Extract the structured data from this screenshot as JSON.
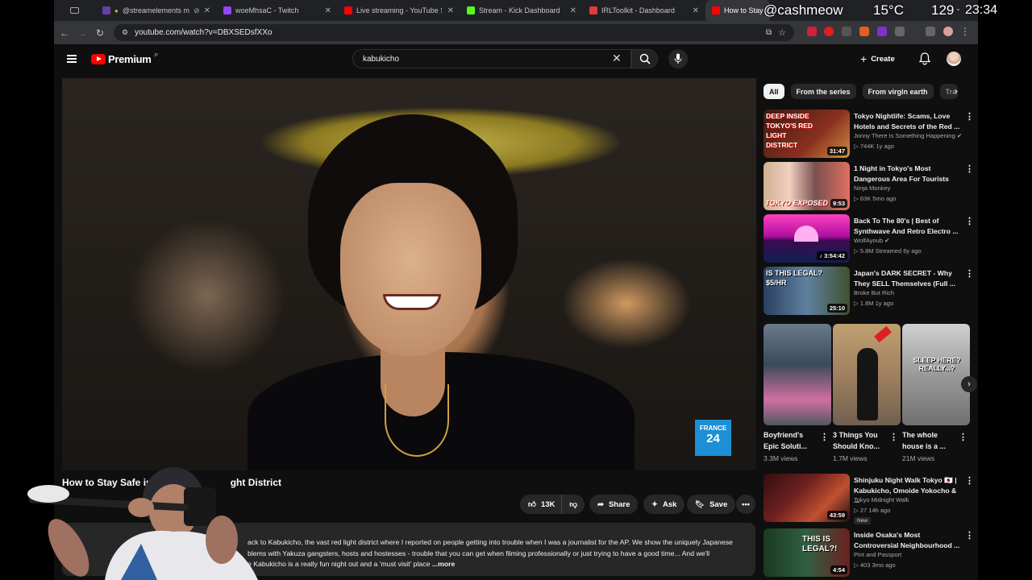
{
  "browser": {
    "tabs": [
      {
        "title": "@streamelements me",
        "fav": "#6441a5"
      },
      {
        "title": "woeMhsaC - Twitch",
        "fav": "#9146ff"
      },
      {
        "title": "Live streaming - YouTube Stu",
        "fav": "#ff0000"
      },
      {
        "title": "Stream - Kick Dashboard",
        "fav": "#53fc18"
      },
      {
        "title": "IRLToolkit - Dashboard",
        "fav": "#e23b3b"
      },
      {
        "title": "How to Stay",
        "fav": "#ff0000"
      }
    ],
    "url": "youtube.com/watch?v=DBXSEDsfXXo"
  },
  "stream_overlay": {
    "handle": "@cashmeow",
    "temperature": "15°C",
    "count": "129",
    "time": "23:34"
  },
  "youtube": {
    "logo": "Premium",
    "logo_region": "JP",
    "search_value": "kabukicho",
    "create_label": "Create",
    "video": {
      "title_left": "How to Stay Safe in T",
      "title_right": "ght District",
      "channel_watermark_line1": "FRANCE",
      "channel_watermark_line2": "24",
      "like_count": "13K",
      "share_label": "Share",
      "ask_label": "Ask",
      "save_label": "Save",
      "description_line1": "ack to Kabukicho, the vast red light district where I reported on people getting into trouble when I was a journalist for the AP. We show the uniquely Japanese",
      "description_line2": "blems with Yakuza gangsters, hosts and hostesses - trouble that you can get when filming professionally or just trying to have a good time... And we'll",
      "description_line3": "e Kabukicho is a really fun night out and a 'must visit' place",
      "more_label": "...more"
    },
    "chips": [
      "All",
      "From the series",
      "From virgin earth",
      "Tra"
    ],
    "recommendations": [
      {
        "title": "Tokyo Nightlife: Scams, Love Hotels and Secrets of the Red ...",
        "channel": "Jonny There Is Something Happening",
        "verified": true,
        "meta": "▷ 744K  1y ago",
        "duration": "31:47",
        "thumb_text": "DEEP INSIDE TOKYO'S RED LIGHT DISTRICT",
        "thumb_color": "#8a3020"
      },
      {
        "title": "1 Night in Tokyo's Most Dangerous Area For Tourists",
        "channel": "Ninja Monkey",
        "verified": false,
        "meta": "▷ 63K  5mo ago",
        "duration": "9:53",
        "thumb_text": "TOKYO EXPOSED",
        "thumb_color": "#b05040"
      },
      {
        "title": "Back To The 80's | Best of Synthwave And Retro Electro ...",
        "channel": "WolfAyoub",
        "verified": true,
        "meta": "▷ 5.8M  Streamed 6y ago",
        "duration": "3:54:42",
        "thumb_text": "",
        "thumb_color": "#c02090"
      },
      {
        "title": "Japan's DARK SECRET - Why They SELL Themselves (Full ...",
        "channel": "Broke But Rich",
        "verified": false,
        "meta": "▷ 1.8M  1y ago",
        "duration": "25:10",
        "thumb_text": "IS THIS LEGAL? $5/HR",
        "thumb_color": "#406080"
      }
    ],
    "shorts": [
      {
        "title": "Boyfriend's Epic Soluti...",
        "views": "3.3M views",
        "color": "#506070"
      },
      {
        "title": "3 Things You Should Kno...",
        "views": "1.7M views",
        "color": "#a08060"
      },
      {
        "title": "The whole house is a ...",
        "views": "21M views",
        "color": "#8a8a8a",
        "thumb_text": "SLEEP HERE? REALLY...?"
      }
    ],
    "recommendations_lower": [
      {
        "title": "Shinjuku Night Walk Tokyo 🇯🇵 | Kabukicho, Omoide Yokocho & ...",
        "channel": "Tokyo Midnight Walk",
        "meta": "▷ 27  14h ago",
        "duration": "43:59",
        "badge": "New",
        "thumb_color": "#502020"
      },
      {
        "title": "Inside Osaka's Most Controversial Neighbourhood ...",
        "channel": "Pint and Passport",
        "meta": "▷ 403  3mo ago",
        "duration": "4:54",
        "thumb_text": "THIS IS LEGAL?!",
        "thumb_color": "#205030"
      }
    ]
  }
}
